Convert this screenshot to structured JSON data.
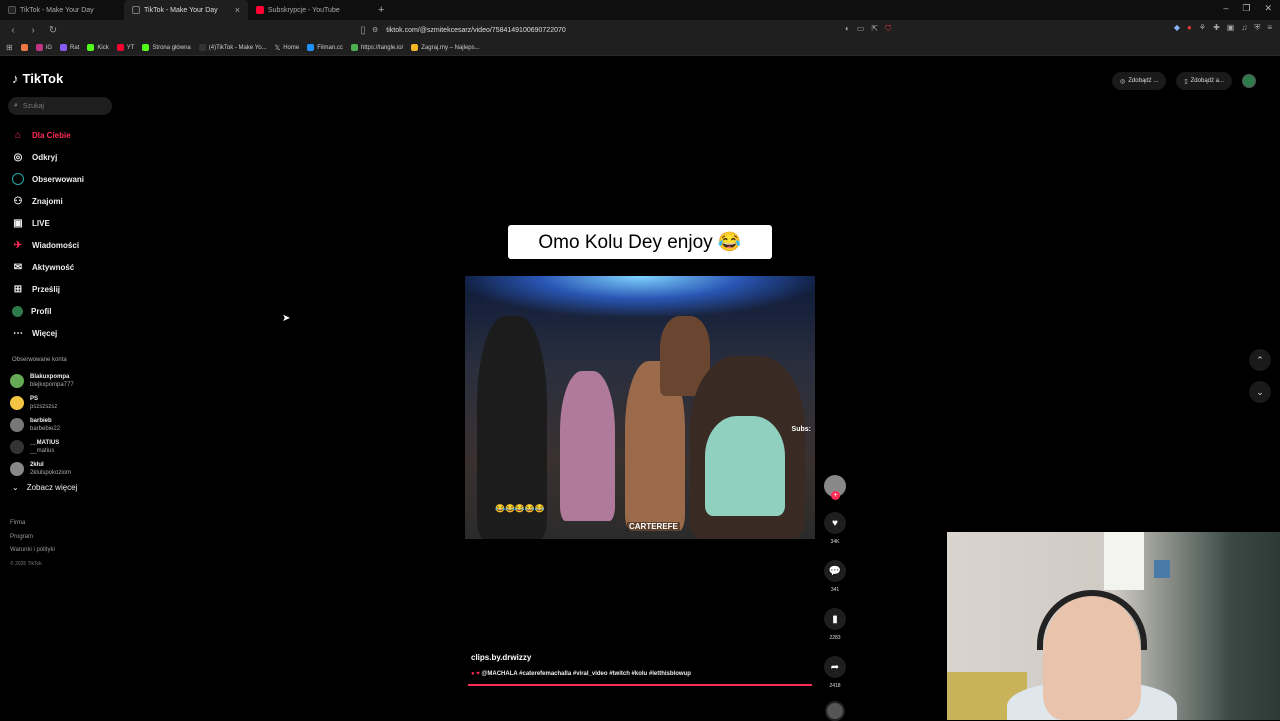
{
  "browser": {
    "tabs": [
      {
        "label": "TikTok - Make Your Day",
        "active": false
      },
      {
        "label": "TikTok - Make Your Day",
        "active": true
      },
      {
        "label": "Subskrypcje - YouTube",
        "active": false
      }
    ],
    "url": "tiktok.com/@szmitekcesarz/video/7584149100690722070",
    "bookmarks": [
      "IG",
      "Rat",
      "Kick",
      "YT",
      "Strona główna",
      "(4)TikTok - Make Yo...",
      "Home",
      "Filman.cc",
      "https://tangle.io/",
      "Zagraj.my – Najleps..."
    ]
  },
  "tiktok": {
    "brand": "TikTok",
    "search_placeholder": "Szukaj",
    "nav": [
      {
        "label": "Dla Ciebie",
        "icon": "home-icon",
        "active": true
      },
      {
        "label": "Odkryj",
        "icon": "compass-icon"
      },
      {
        "label": "Obserwowani",
        "icon": "following-icon"
      },
      {
        "label": "Znajomi",
        "icon": "friends-icon"
      },
      {
        "label": "LIVE",
        "icon": "live-icon"
      },
      {
        "label": "Wiadomości",
        "icon": "messages-icon"
      },
      {
        "label": "Aktywność",
        "icon": "activity-icon"
      },
      {
        "label": "Prześlij",
        "icon": "upload-icon"
      },
      {
        "label": "Profil",
        "icon": "profile-icon"
      },
      {
        "label": "Więcej",
        "icon": "more-icon"
      }
    ],
    "followed_title": "Obserwowane konta",
    "followed_accounts": [
      {
        "name": "Blakuxpompa",
        "handle": "blejkxpompa777"
      },
      {
        "name": "PS",
        "handle": "pszszszsz"
      },
      {
        "name": "barbieb",
        "handle": "barbebie22"
      },
      {
        "name": "__MATIUS",
        "handle": "__matius"
      },
      {
        "name": "2kłul",
        "handle": "2klulspokoziom"
      }
    ],
    "see_more": "Zobacz więcej",
    "footer": [
      "Firma",
      "Program",
      "Warunki i polityki"
    ],
    "copyright": "© 2026 TikTok",
    "top_right": [
      "Zdobądź ...",
      "Zdobądź a..."
    ],
    "video": {
      "caption": "Omo Kolu Dey enjoy 😂",
      "overlay_sub": "Subs:",
      "overlay_emoji": "😂😂😂😂😂",
      "watermark": "CARTEREFE",
      "author": "clips.by.drwizzy",
      "description": "@MACHALA #caterefemachalla #viral_video #twitch #kolu #letthisblowup",
      "progress": 1.0
    },
    "actions": [
      {
        "icon": "heart-icon",
        "count": "34K"
      },
      {
        "icon": "comment-icon",
        "count": "341"
      },
      {
        "icon": "bookmark-icon",
        "count": "2283"
      },
      {
        "icon": "share-icon",
        "count": "2418"
      }
    ]
  }
}
